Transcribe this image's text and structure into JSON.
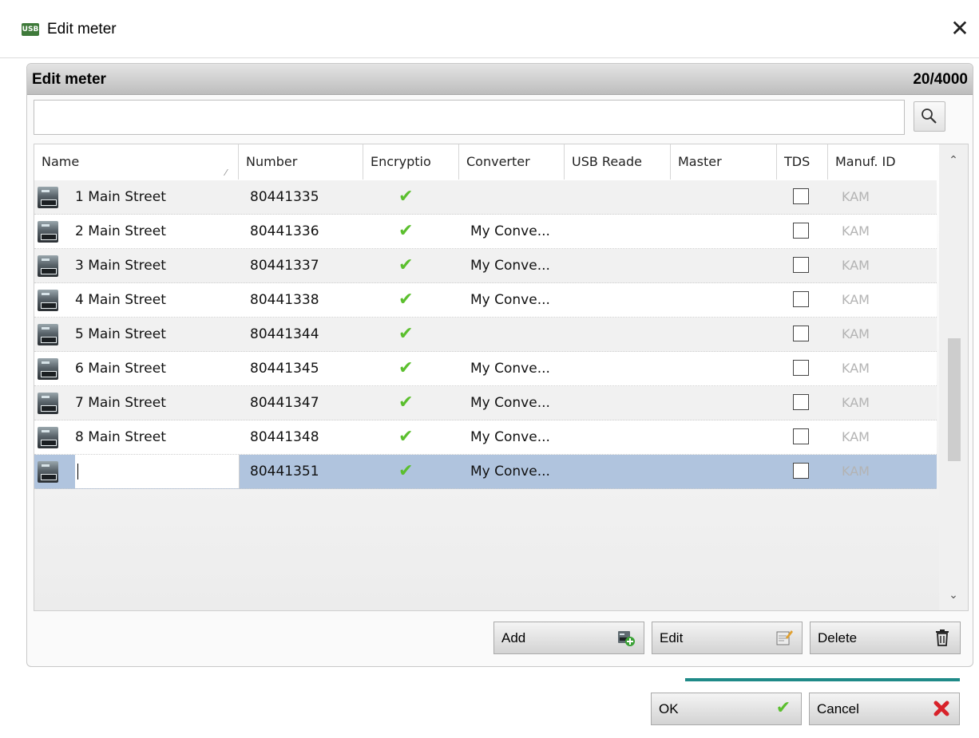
{
  "window": {
    "app_icon_text": "USB",
    "title": "Edit meter",
    "close_glyph": "✕"
  },
  "panel": {
    "title": "Edit meter",
    "count": "20/4000"
  },
  "search": {
    "value": "",
    "placeholder": "",
    "icon": "search-icon"
  },
  "grid": {
    "columns": [
      {
        "key": "name",
        "label": "Name",
        "sorted": true
      },
      {
        "key": "number",
        "label": "Number"
      },
      {
        "key": "encryption",
        "label": "Encryptio"
      },
      {
        "key": "converter",
        "label": "Converter"
      },
      {
        "key": "usb_reader",
        "label": "USB Reade"
      },
      {
        "key": "master",
        "label": "Master"
      },
      {
        "key": "tds",
        "label": "TDS"
      },
      {
        "key": "manuf_id",
        "label": "Manuf. ID"
      }
    ],
    "sort_glyph": "⁄",
    "rows": [
      {
        "name": "1 Main Street",
        "number": "80441335",
        "encryption": true,
        "converter": "",
        "usb_reader": "",
        "master": "",
        "tds": false,
        "manuf_id": "KAM"
      },
      {
        "name": "2 Main Street",
        "number": "80441336",
        "encryption": true,
        "converter": "My Conve...",
        "usb_reader": "",
        "master": "",
        "tds": false,
        "manuf_id": "KAM"
      },
      {
        "name": "3 Main Street",
        "number": "80441337",
        "encryption": true,
        "converter": "My Conve...",
        "usb_reader": "",
        "master": "",
        "tds": false,
        "manuf_id": "KAM"
      },
      {
        "name": "4 Main Street",
        "number": "80441338",
        "encryption": true,
        "converter": "My Conve...",
        "usb_reader": "",
        "master": "",
        "tds": false,
        "manuf_id": "KAM"
      },
      {
        "name": "5 Main Street",
        "number": "80441344",
        "encryption": true,
        "converter": "",
        "usb_reader": "",
        "master": "",
        "tds": false,
        "manuf_id": "KAM"
      },
      {
        "name": "6 Main Street",
        "number": "80441345",
        "encryption": true,
        "converter": "My Conve...",
        "usb_reader": "",
        "master": "",
        "tds": false,
        "manuf_id": "KAM"
      },
      {
        "name": "7 Main Street",
        "number": "80441347",
        "encryption": true,
        "converter": "My Conve...",
        "usb_reader": "",
        "master": "",
        "tds": false,
        "manuf_id": "KAM"
      },
      {
        "name": "8 Main Street",
        "number": "80441348",
        "encryption": true,
        "converter": "My Conve...",
        "usb_reader": "",
        "master": "",
        "tds": false,
        "manuf_id": "KAM"
      },
      {
        "name": "",
        "number": "80441351",
        "encryption": true,
        "converter": "My Conve...",
        "usb_reader": "",
        "master": "",
        "tds": false,
        "manuf_id": "KAM",
        "selected": true,
        "editing": true
      }
    ],
    "check_glyph": "✔",
    "scroll_up_glyph": "⌃",
    "scroll_down_glyph": "⌄"
  },
  "actions": {
    "add_label": "Add",
    "add_icon": "add-meter-icon",
    "edit_label": "Edit",
    "edit_icon": "edit-note-icon",
    "delete_label": "Delete",
    "delete_icon": "trash-icon"
  },
  "footer": {
    "ok_label": "OK",
    "ok_icon": "check-icon",
    "cancel_label": "Cancel",
    "cancel_icon": "red-x-icon"
  },
  "colors": {
    "selected_row": "#b0c4de",
    "accent_line": "#1f8a88",
    "check_green": "#5bbf2e",
    "cancel_red": "#d8222a"
  }
}
